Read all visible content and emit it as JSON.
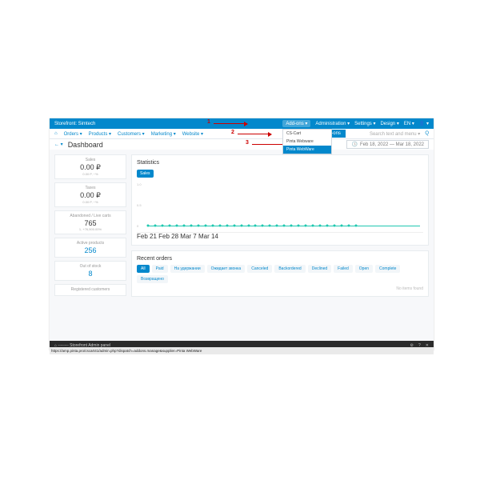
{
  "topbar": {
    "storefront": "Storefront: Simtech",
    "addons": "Add-ons ▾",
    "admin": "Administration ▾",
    "settings": "Settings ▾",
    "design": "Design ▾",
    "lang": "EN ▾",
    "user": "👤 ▾"
  },
  "menubar": {
    "home": "⌂",
    "orders": "Orders ▾",
    "products": "Products ▾",
    "customers": "Customers ▾",
    "marketing": "Marketing ▾",
    "website": "Website ▾",
    "manage": "Manage add-ons",
    "search_ph": "Search text and menu ▾",
    "q": "Q"
  },
  "dropdown": {
    "i1": "CS-Cart",
    "i2": "Pinta Webware",
    "i3": "Pinta WebWare"
  },
  "header": {
    "back": "← ▾",
    "title": "Dashboard",
    "date": "Feb 18, 2022 — Mar 18, 2022",
    "clock": "🕓"
  },
  "side": {
    "sales": {
      "lbl": "Sales",
      "val": "0.00 ₽",
      "sub": "0.00 P, −%"
    },
    "taxes": {
      "lbl": "Taxes",
      "val": "0.00 ₽",
      "sub": "0.00 P, −%"
    },
    "aband": {
      "lbl": "Abandoned / Live carts",
      "val": "765",
      "sub": "1, +76,500.00%"
    },
    "active": {
      "lbl": "Active products",
      "val": "256"
    },
    "oos": {
      "lbl": "Out of stock",
      "val": "8"
    },
    "reg": {
      "lbl": "Registered customers"
    }
  },
  "stats": {
    "title": "Statistics",
    "tab": "Sales"
  },
  "chart_data": {
    "type": "line",
    "yticks": [
      "1.0",
      "0.5",
      "0"
    ],
    "xticks": [
      "Feb 21",
      "Feb 28",
      "Mar 7",
      "Mar 14"
    ],
    "series": [
      {
        "name": "Sales",
        "values": [
          0,
          0,
          0,
          0,
          0,
          0,
          0,
          0,
          0,
          0,
          0,
          0,
          0,
          0,
          0,
          0,
          0,
          0,
          0,
          0,
          0,
          0,
          0,
          0,
          0,
          0,
          0,
          0,
          0,
          0
        ]
      }
    ],
    "ylim": [
      0,
      1
    ]
  },
  "orders": {
    "title": "Recent orders",
    "tabs": [
      "All",
      "Paid",
      "На удержании",
      "Ожидает звонка",
      "Canceled",
      "Backordered",
      "Declined",
      "Failed",
      "Open",
      "Complete",
      "Возвращено"
    ],
    "noitems": "No items found"
  },
  "bottom": {
    "left": "⌂ --------   Storefront   Admin panel",
    "gear": "⚙",
    "help": "?",
    "close": "✕"
  },
  "status": {
    "url": "https://amp.pinta.pro/cscart41/admin.php?dispatch=addons.manage&supplier=Pinta WebWare"
  },
  "annot": {
    "n1": "1",
    "n2": "2",
    "n3": "3"
  }
}
